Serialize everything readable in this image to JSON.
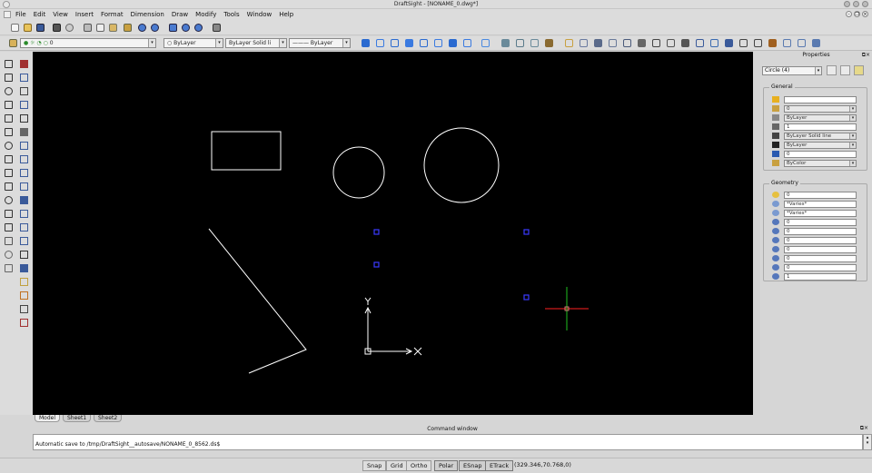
{
  "window": {
    "title": "DraftSight - [NONAME_0.dwg*]"
  },
  "menu": {
    "items": [
      "File",
      "Edit",
      "View",
      "Insert",
      "Format",
      "Dimension",
      "Draw",
      "Modify",
      "Tools",
      "Window",
      "Help"
    ]
  },
  "layer_bar": {
    "layer_value": "0",
    "color_value": "ByLayer",
    "linestyle_value": "ByLayer    Solid li",
    "lineweight_value": "ByLayer"
  },
  "tabs": [
    "Model",
    "Sheet1",
    "Sheet2"
  ],
  "properties": {
    "title": "Properties",
    "selection": "Circle (4)",
    "general_label": "General",
    "general": [
      {
        "icon": "color-wheel-icon",
        "value": ""
      },
      {
        "icon": "layer-icon",
        "value": "0"
      },
      {
        "icon": "color-icon",
        "value": "ByLayer"
      },
      {
        "icon": "scale-icon",
        "value": "1"
      },
      {
        "icon": "linestyle-icon",
        "value": "ByLayer    Solid line"
      },
      {
        "icon": "lineweight-icon",
        "value": "ByLayer"
      },
      {
        "icon": "handle-icon",
        "value": "0"
      },
      {
        "icon": "print-style-icon",
        "value": "ByColor"
      }
    ],
    "geometry_label": "Geometry",
    "geometry": [
      "0",
      "*Varies*",
      "*Varies*",
      "0",
      "0",
      "0",
      "0",
      "0",
      "0",
      "1"
    ]
  },
  "command": {
    "title": "Command window",
    "log": "Automatic save to /tmp/DraftSight__autosave/NONAME_0_8562.ds$"
  },
  "status": {
    "buttons": [
      "Snap",
      "Grid",
      "Ortho",
      "Polar",
      "ESnap",
      "ETrack"
    ],
    "coordinates": "(329.346,70.768,0)"
  },
  "colors": {
    "canvas": "#000000",
    "entity": "#ffffff",
    "grip": "#3a3aff",
    "cursor_x": "#ff2020",
    "cursor_y": "#20c020"
  }
}
